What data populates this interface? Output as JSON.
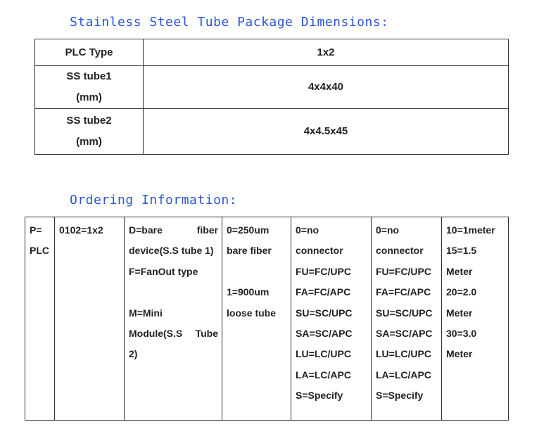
{
  "headings": {
    "package": "Stainless Steel Tube Package Dimensions:",
    "ordering": "Ordering Information:"
  },
  "dimensions_table": {
    "rows": [
      {
        "label": [
          "PLC Type"
        ],
        "value": "1x2"
      },
      {
        "label": [
          "SS tube1",
          "(mm)"
        ],
        "value": "4x4x40"
      },
      {
        "label": [
          "SS tube2",
          "(mm)"
        ],
        "value": "4x4.5x45"
      }
    ]
  },
  "ordering_table": {
    "columns": [
      {
        "lines": [
          "P=",
          "PLC"
        ]
      },
      {
        "lines": [
          "0102=1x2"
        ]
      },
      {
        "lines": [
          [
            "D=bare",
            "fiber"
          ],
          "device(S.S tube 1)",
          "F=FanOut type",
          "",
          "M=Mini",
          [
            "Module(S.S",
            "Tube"
          ],
          "2)"
        ]
      },
      {
        "lines": [
          "0=250um",
          "bare fiber",
          "",
          "1=900um",
          "loose tube"
        ]
      },
      {
        "lines": [
          "0=no",
          "connector",
          "FU=FC/UPC",
          "FA=FC/APC",
          "SU=SC/UPC",
          "SA=SC/APC",
          "LU=LC/UPC",
          "LA=LC/APC",
          "S=Specify"
        ]
      },
      {
        "lines": [
          "0=no",
          "connector",
          "FU=FC/UPC",
          "FA=FC/APC",
          "SU=SC/UPC",
          "SA=SC/APC",
          "LU=LC/UPC",
          "LA=LC/APC",
          "S=Specify"
        ]
      },
      {
        "lines": [
          "10=1meter",
          "15=1.5",
          "Meter",
          "20=2.0",
          "Meter",
          "30=3.0",
          "Meter"
        ]
      }
    ]
  },
  "colors": {
    "heading": "#2d55d8",
    "border": "#333333",
    "text": "#222222"
  }
}
